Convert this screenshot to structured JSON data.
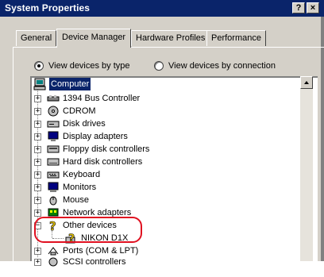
{
  "window": {
    "title": "System Properties",
    "help_btn": "?",
    "second_btn": "×"
  },
  "tabs": [
    {
      "label": "General"
    },
    {
      "label": "Device Manager"
    },
    {
      "label": "Hardware Profiles"
    },
    {
      "label": "Performance"
    }
  ],
  "view_options": {
    "by_type": "View devices by type",
    "by_connection": "View devices by connection",
    "selected": "by_type"
  },
  "tree": {
    "root": "Computer",
    "items": [
      {
        "label": "1394 Bus Controller",
        "icon": "bus-controller-icon"
      },
      {
        "label": "CDROM",
        "icon": "cdrom-icon"
      },
      {
        "label": "Disk drives",
        "icon": "disk-drive-icon"
      },
      {
        "label": "Display adapters",
        "icon": "display-adapter-icon"
      },
      {
        "label": "Floppy disk controllers",
        "icon": "floppy-controller-icon"
      },
      {
        "label": "Hard disk controllers",
        "icon": "hard-disk-controller-icon"
      },
      {
        "label": "Keyboard",
        "icon": "keyboard-icon"
      },
      {
        "label": "Monitors",
        "icon": "monitor-icon"
      },
      {
        "label": "Mouse",
        "icon": "mouse-icon"
      },
      {
        "label": "Network adapters",
        "icon": "network-adapter-icon"
      },
      {
        "label": "Other devices",
        "icon": "unknown-device-icon",
        "expanded": true
      },
      {
        "label": "NIKON D1X",
        "icon": "unknown-device-icon",
        "child": true
      },
      {
        "label": "Ports (COM & LPT)",
        "icon": "port-icon"
      },
      {
        "label": "SCSI controllers",
        "icon": "scsi-icon"
      }
    ]
  },
  "colors": {
    "titlebar": "#0a246a",
    "highlight_ring": "#e01020",
    "face": "#d4d0c8"
  }
}
